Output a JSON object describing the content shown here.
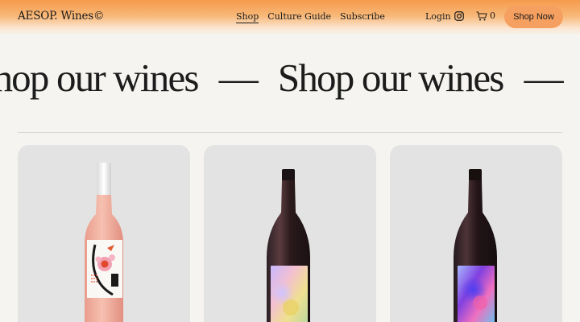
{
  "header": {
    "logo": "AESOP. Wines©",
    "nav": [
      {
        "label": "Shop",
        "active": true
      },
      {
        "label": "Culture Guide",
        "active": false
      },
      {
        "label": "Subscribe",
        "active": false
      }
    ],
    "login_label": "Login",
    "cart_count": "0",
    "cta_label": "Shop Now",
    "accent_color": "#f5a060"
  },
  "hero": {
    "marquee_text": "Shop our wines",
    "separator": "—"
  },
  "products": [
    {
      "wine": "rosé",
      "bottle_color": "#f0a89a"
    },
    {
      "wine": "red",
      "bottle_color": "#2a1a1c"
    },
    {
      "wine": "red",
      "bottle_color": "#1f1418"
    }
  ]
}
